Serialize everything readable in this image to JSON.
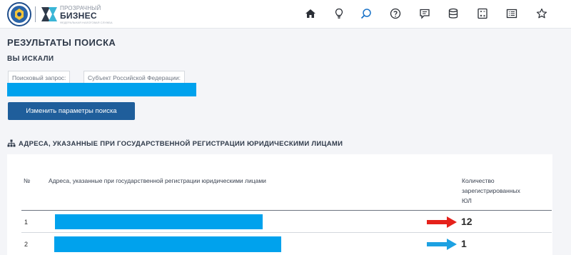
{
  "header": {
    "brand_small": "ПРОЗРАЧНЫЙ",
    "brand_big": "БИЗНЕС",
    "brand_tagline": "ФЕДЕРАЛЬНАЯ НАЛОГОВАЯ СЛУЖБА",
    "nav_icons": [
      "home-icon",
      "lightbulb-icon",
      "search-icon",
      "help-icon",
      "chat-icon",
      "database-icon",
      "calculator-icon",
      "list-icon",
      "star-icon"
    ],
    "active_icon": "search-icon",
    "accent_color": "#1a73c8"
  },
  "page": {
    "title": "РЕЗУЛЬТАТЫ ПОИСКА",
    "searched_title": "ВЫ ИСКАЛИ",
    "query_label": "Поисковый запрос:",
    "region_label": "Субъект Российской Федерации:",
    "change_button": "Изменить параметры поиска"
  },
  "section": {
    "icon": "sitemap-icon",
    "title": "АДРЕСА, УКАЗАННЫЕ ПРИ ГОСУДАРСТВЕННОЙ РЕГИСТРАЦИИ ЮРИДИЧЕСКИМИ ЛИЦАМИ"
  },
  "table": {
    "columns": [
      "№",
      "Адреса, указанные при государственной регистрации юридическими лицами",
      "Количество зарегистрированных ЮЛ"
    ],
    "count_header_lines": [
      "Количество",
      "зарегистрированных",
      "ЮЛ"
    ],
    "rows": [
      {
        "num": "1",
        "count": "12",
        "arrow_color": "#e5211b"
      },
      {
        "num": "2",
        "count": "1",
        "arrow_color": "#1da1e2"
      }
    ]
  },
  "redaction_color": "#00a2ed"
}
